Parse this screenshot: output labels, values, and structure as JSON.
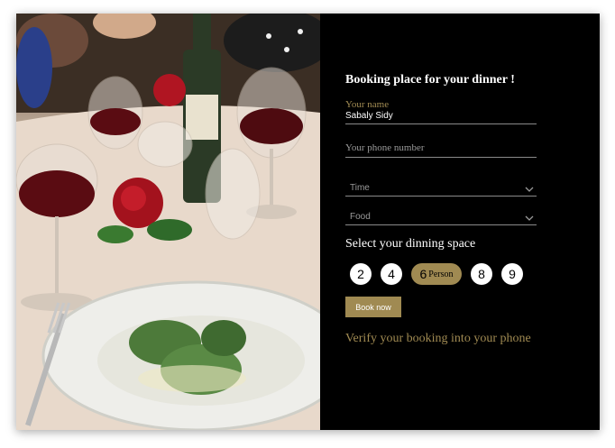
{
  "form": {
    "title": "Booking place for your dinner !",
    "name_label": "Your name",
    "name_value": "Sabaly Sidy",
    "phone_placeholder": "Your phone number",
    "time_label": "Time",
    "food_label": "Food",
    "dining_space_title": "Select your dinning space",
    "person_options": [
      "2",
      "4",
      "6",
      "8",
      "9"
    ],
    "selected_person": "6",
    "person_unit": "Person",
    "book_button": "Book now",
    "verify_text": "Verify your booking into your phone"
  },
  "colors": {
    "accent": "#a08a52",
    "panel_bg": "#000000",
    "text": "#ffffff"
  },
  "icons": {
    "time_dropdown": "chevron-down-icon",
    "food_dropdown": "chevron-down-icon"
  }
}
